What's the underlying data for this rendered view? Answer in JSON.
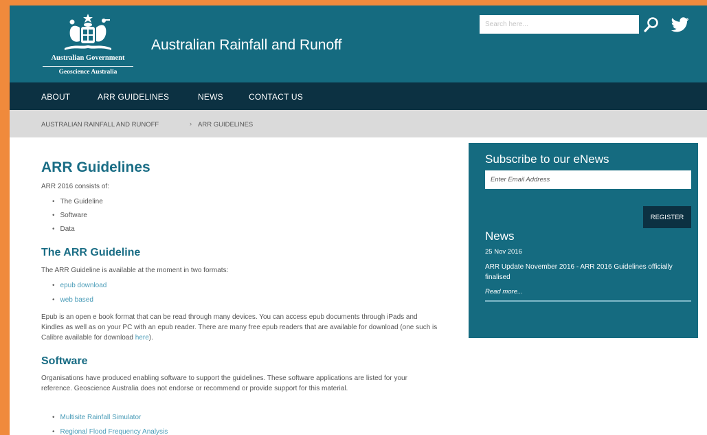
{
  "header": {
    "gov_name": "Australian Government",
    "agency_name": "Geoscience Australia",
    "site_title": "Australian Rainfall and Runoff",
    "search_placeholder": "Search here...",
    "search_icon": "search-icon",
    "twitter_icon": "twitter-icon",
    "bg_color": "#156b80"
  },
  "nav": {
    "items": [
      {
        "label": "ABOUT"
      },
      {
        "label": "ARR GUIDELINES"
      },
      {
        "label": "NEWS"
      },
      {
        "label": "CONTACT US"
      }
    ],
    "bg_color": "#0c3142"
  },
  "breadcrumb": {
    "items": [
      {
        "label": "AUSTRALIAN RAINFALL AND RUNOFF"
      },
      {
        "label": "ARR GUIDELINES"
      }
    ],
    "separator": "›"
  },
  "main": {
    "title": "ARR Guidelines",
    "intro": "ARR 2016 consists of:",
    "intro_items": [
      "The Guideline",
      "Software",
      "Data"
    ],
    "guideline_heading": "The ARR Guideline",
    "guideline_text": "The ARR Guideline is available at the moment in two formats:",
    "guideline_links": [
      "epub download",
      "web based"
    ],
    "epub_text": "Epub is an open e book format that can be read through many devices. You can access epub documents through iPads and Kindles as well as on your PC with an epub reader. There are many free epub readers that are available for download (one such is Calibre available for download ",
    "epub_link": "here",
    "epub_tail": ").",
    "software_heading": "Software",
    "software_text": "Organisations have produced enabling software to support the guidelines. These software applications are listed for your reference. Geoscience Australia does not endorse or recommend or provide support for this material.",
    "software_links": [
      "Multisite Rainfall Simulator",
      "Regional Flood Frequency Analysis"
    ]
  },
  "sidebar": {
    "subscribe_title": "Subscribe to our eNews",
    "email_placeholder": "Enter Email Address",
    "register_label": "REGISTER",
    "news_title": "News",
    "news_date": "25 Nov 2016",
    "news_headline": "ARR Update November 2016 - ARR 2016 Guidelines officially finalised",
    "news_readmore": "Read more..."
  },
  "colors": {
    "accent": "#1a6d85",
    "link": "#4a9cb8",
    "frame": "#f08a3c"
  }
}
